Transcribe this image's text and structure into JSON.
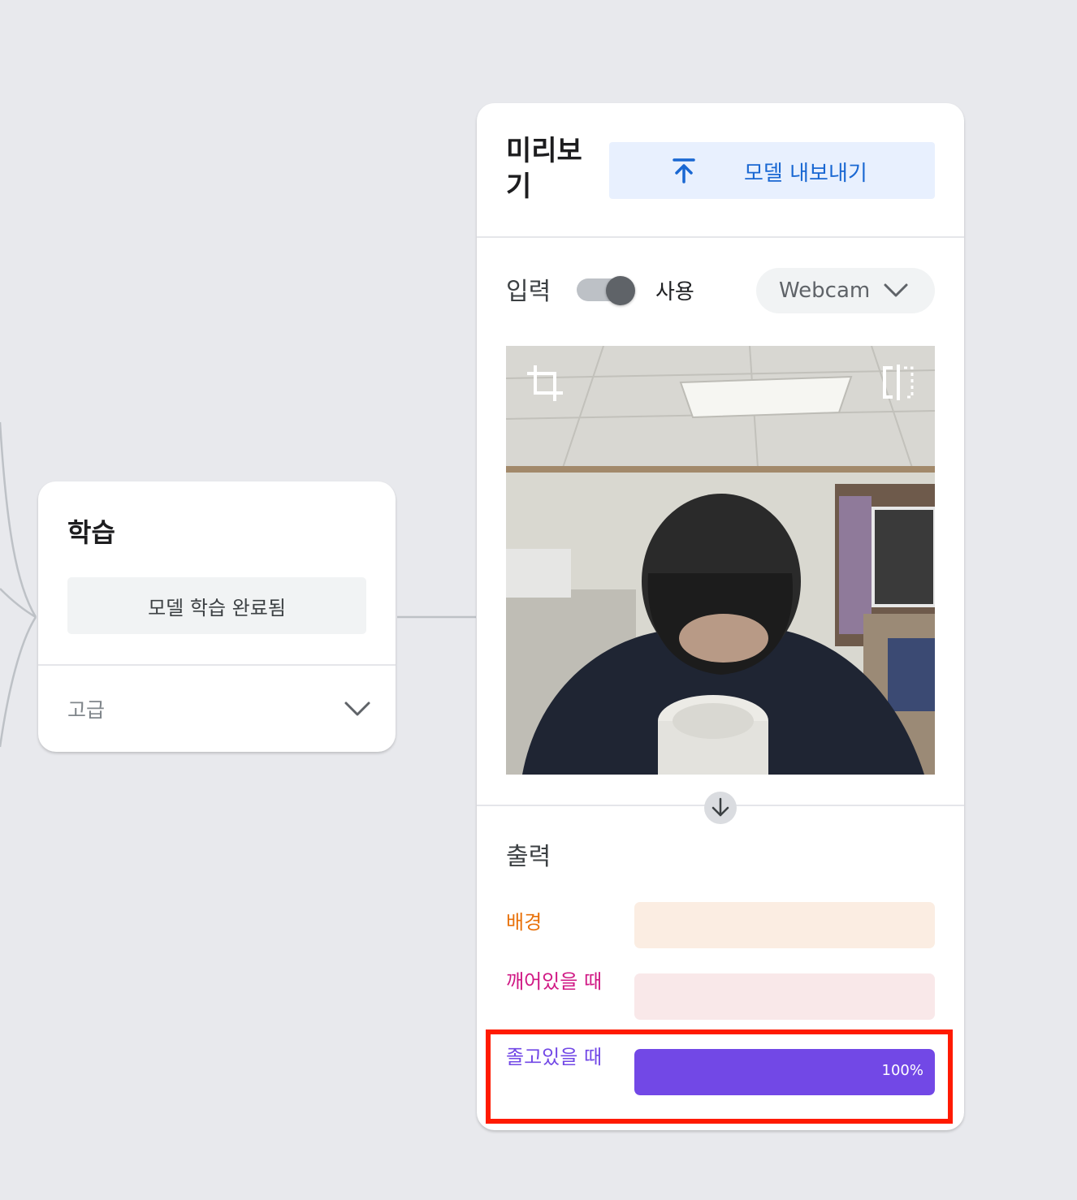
{
  "training": {
    "title": "학습",
    "status_button": "모델 학습 완료됨",
    "advanced_label": "고급"
  },
  "preview": {
    "title": "미리보기",
    "export_button": "모델 내보내기",
    "input": {
      "label": "입력",
      "toggle_label": "사용",
      "toggle_on": true,
      "source": "Webcam"
    },
    "output": {
      "label": "출력",
      "classes": [
        {
          "name": "배경",
          "value": 0,
          "percent_text": "",
          "color": "#e8710a",
          "track": "#fbede2"
        },
        {
          "name": "깨어있을 때",
          "value": 0,
          "percent_text": "",
          "color": "#d01884",
          "track": "#f9e8e9"
        },
        {
          "name": "졸고있을 때",
          "value": 1.0,
          "percent_text": "100%",
          "color": "#7248e6",
          "track": "#ece6fb"
        }
      ]
    }
  }
}
